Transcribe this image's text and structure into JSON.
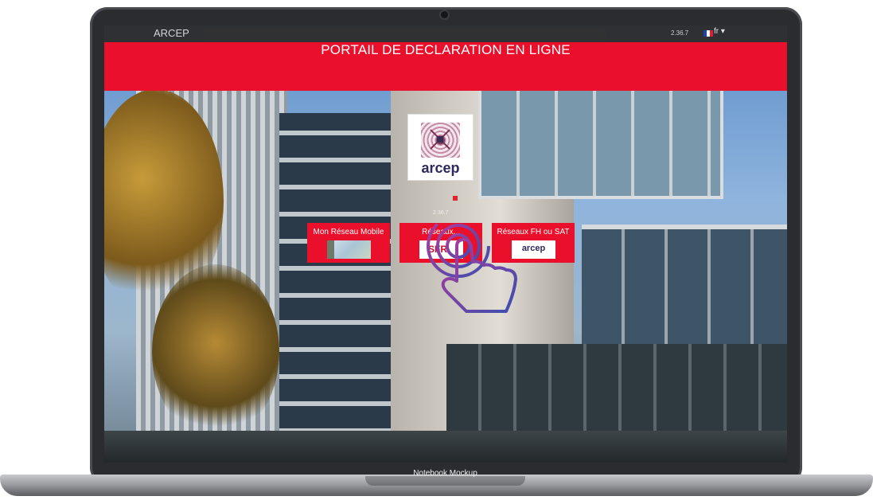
{
  "navbar": {
    "brand": "ARCEP",
    "version": "2.36.7",
    "language": "fr ▾"
  },
  "banner": {
    "title": "PORTAIL DE DECLARATION EN LIGNE"
  },
  "logo": {
    "text": "arcep"
  },
  "center": {
    "version": "2.36.7"
  },
  "tiles": [
    {
      "label": "Mon Réseau Mobile",
      "image": "map"
    },
    {
      "label": "Réseaux...",
      "image_text": "SFR"
    },
    {
      "label": "Réseaux FH ou SAT",
      "image_text": "arcep"
    }
  ],
  "mockup_label": "Notebook Mockup",
  "colors": {
    "accent": "#ea0f2b",
    "navbar": "#2d2d2d",
    "cursor_gradient_start": "#b03a9c",
    "cursor_gradient_end": "#3b4fb0"
  },
  "icons": {
    "cursor": "tap-hand-icon",
    "flag": "france-flag-icon"
  }
}
